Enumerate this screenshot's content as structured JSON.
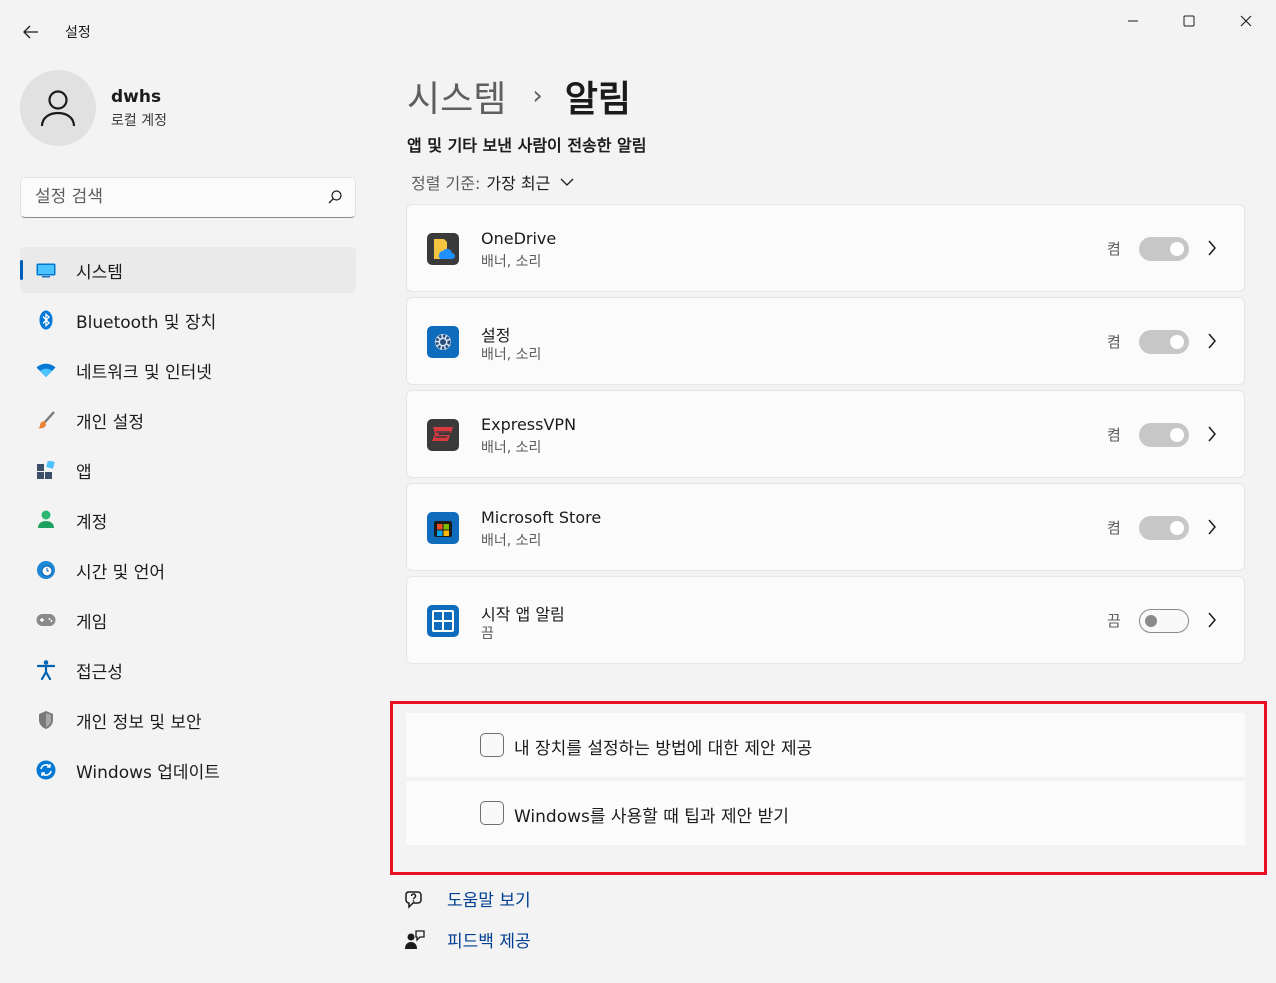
{
  "window": {
    "title": "설정",
    "controls": {
      "minimize_icon": "minimize-icon",
      "maximize_icon": "maximize-icon",
      "close_icon": "close-icon"
    }
  },
  "profile": {
    "name": "dwhs",
    "account_type": "로컬 계정"
  },
  "search": {
    "placeholder": "설정 검색",
    "value": ""
  },
  "sidebar": {
    "items": [
      {
        "label": "시스템",
        "icon": "monitor-icon",
        "active": true
      },
      {
        "label": "Bluetooth 및 장치",
        "icon": "bluetooth-icon"
      },
      {
        "label": "네트워크 및 인터넷",
        "icon": "wifi-icon"
      },
      {
        "label": "개인 설정",
        "icon": "paintbrush-icon"
      },
      {
        "label": "앱",
        "icon": "apps-icon"
      },
      {
        "label": "계정",
        "icon": "person-icon"
      },
      {
        "label": "시간 및 언어",
        "icon": "globe-clock-icon"
      },
      {
        "label": "게임",
        "icon": "gamepad-icon"
      },
      {
        "label": "접근성",
        "icon": "accessibility-icon"
      },
      {
        "label": "개인 정보 및 보안",
        "icon": "shield-icon"
      },
      {
        "label": "Windows 업데이트",
        "icon": "update-icon"
      }
    ]
  },
  "breadcrumb": {
    "parent": "시스템",
    "separator": "›",
    "current": "알림"
  },
  "section_title": "앱 및 기타 보낸 사람이 전송한 알림",
  "sort": {
    "label": "정렬 기준:",
    "value": "가장 최근"
  },
  "apps": [
    {
      "name": "OneDrive",
      "subtitle": "배너, 소리",
      "state_label": "켬",
      "on": true,
      "icon": "onedrive-icon"
    },
    {
      "name": "설정",
      "subtitle": "배너, 소리",
      "state_label": "켬",
      "on": true,
      "icon": "settings-gear-icon"
    },
    {
      "name": "ExpressVPN",
      "subtitle": "배너, 소리",
      "state_label": "켬",
      "on": true,
      "icon": "expressvpn-icon"
    },
    {
      "name": "Microsoft Store",
      "subtitle": "배너, 소리",
      "state_label": "켬",
      "on": true,
      "icon": "store-icon"
    },
    {
      "name": "시작 앱 알림",
      "subtitle": "끔",
      "state_label": "끔",
      "on": false,
      "icon": "startup-apps-icon"
    }
  ],
  "checkboxes": [
    {
      "label": "내 장치를 설정하는 방법에 대한 제안 제공",
      "checked": false
    },
    {
      "label": "Windows를 사용할 때 팁과 제안 받기",
      "checked": false
    }
  ],
  "links": [
    {
      "label": "도움말 보기",
      "icon": "help-icon"
    },
    {
      "label": "피드백 제공",
      "icon": "feedback-icon"
    }
  ],
  "colors": {
    "accent": "#005fb8",
    "highlight_border": "#e81123",
    "link": "#003e92"
  }
}
